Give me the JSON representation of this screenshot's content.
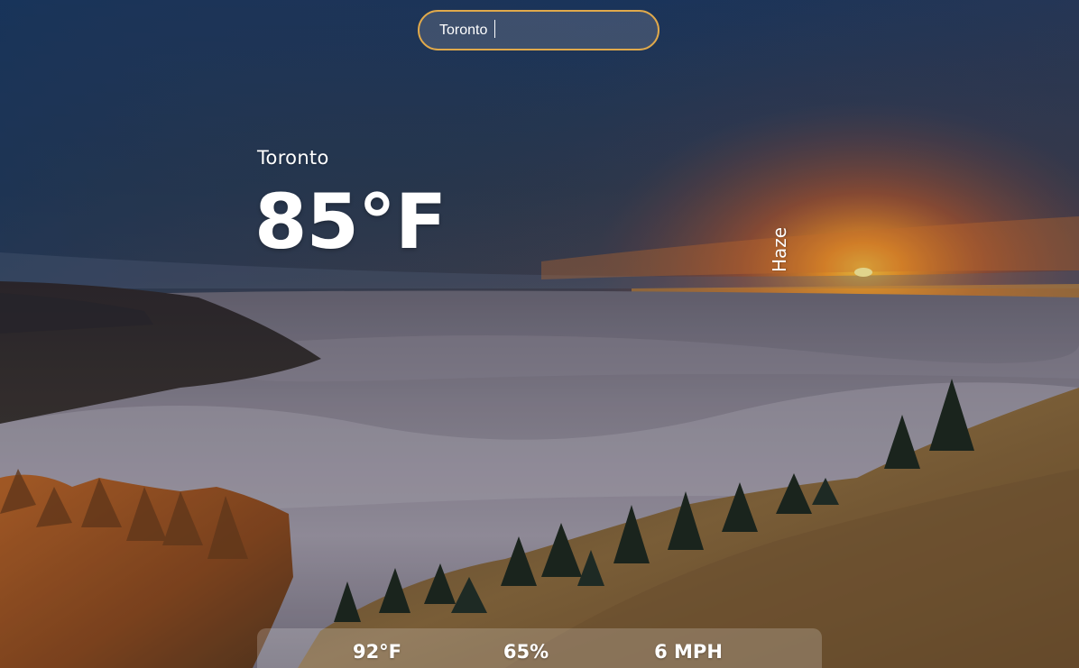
{
  "search": {
    "value": "Toronto",
    "placeholder": ""
  },
  "weather": {
    "city": "Toronto",
    "temperature": "85°F",
    "condition": "Haze"
  },
  "stats": {
    "feels_like": "92°F",
    "humidity": "65%",
    "wind": "6 MPH"
  },
  "colors": {
    "search_border": "#e0a94b",
    "text": "#ffffff"
  }
}
